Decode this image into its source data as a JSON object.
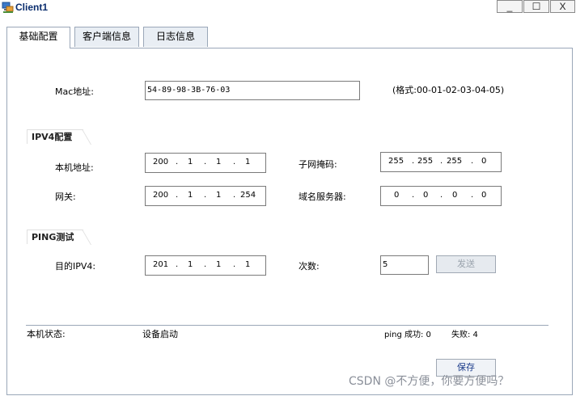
{
  "window": {
    "title": "Client1",
    "min_label": "_",
    "max_label": "☐",
    "close_label": "X",
    "icon": "network-client-icon"
  },
  "tabs": [
    {
      "label": "基础配置",
      "active": true
    },
    {
      "label": "客户端信息",
      "active": false
    },
    {
      "label": "日志信息",
      "active": false
    }
  ],
  "mac": {
    "label": "Mac地址:",
    "value": "54-89-98-3B-76-03",
    "format_hint": "(格式:00-01-02-03-04-05)"
  },
  "ipv4": {
    "title": "IPV4配置",
    "ip_label": "本机地址:",
    "ip": [
      "200",
      "1",
      "1",
      "1"
    ],
    "mask_label": "子网掩码:",
    "mask": [
      "255",
      "255",
      "255",
      "0"
    ],
    "gateway_label": "网关:",
    "gateway": [
      "200",
      "1",
      "1",
      "254"
    ],
    "dns_label": "域名服务器:",
    "dns": [
      "0",
      "0",
      "0",
      "0"
    ]
  },
  "ping": {
    "title": "PING测试",
    "dest_label": "目的IPV4:",
    "dest": [
      "201",
      "1",
      "1",
      "1"
    ],
    "count_label": "次数:",
    "count": "5",
    "send_label": "发送"
  },
  "status": {
    "label": "本机状态:",
    "value": "设备启动",
    "ping_success": "ping 成功: 0",
    "fail": "失败: 4"
  },
  "save_label": "保存",
  "watermark": "CSDN @不方便，你要方便吗？"
}
